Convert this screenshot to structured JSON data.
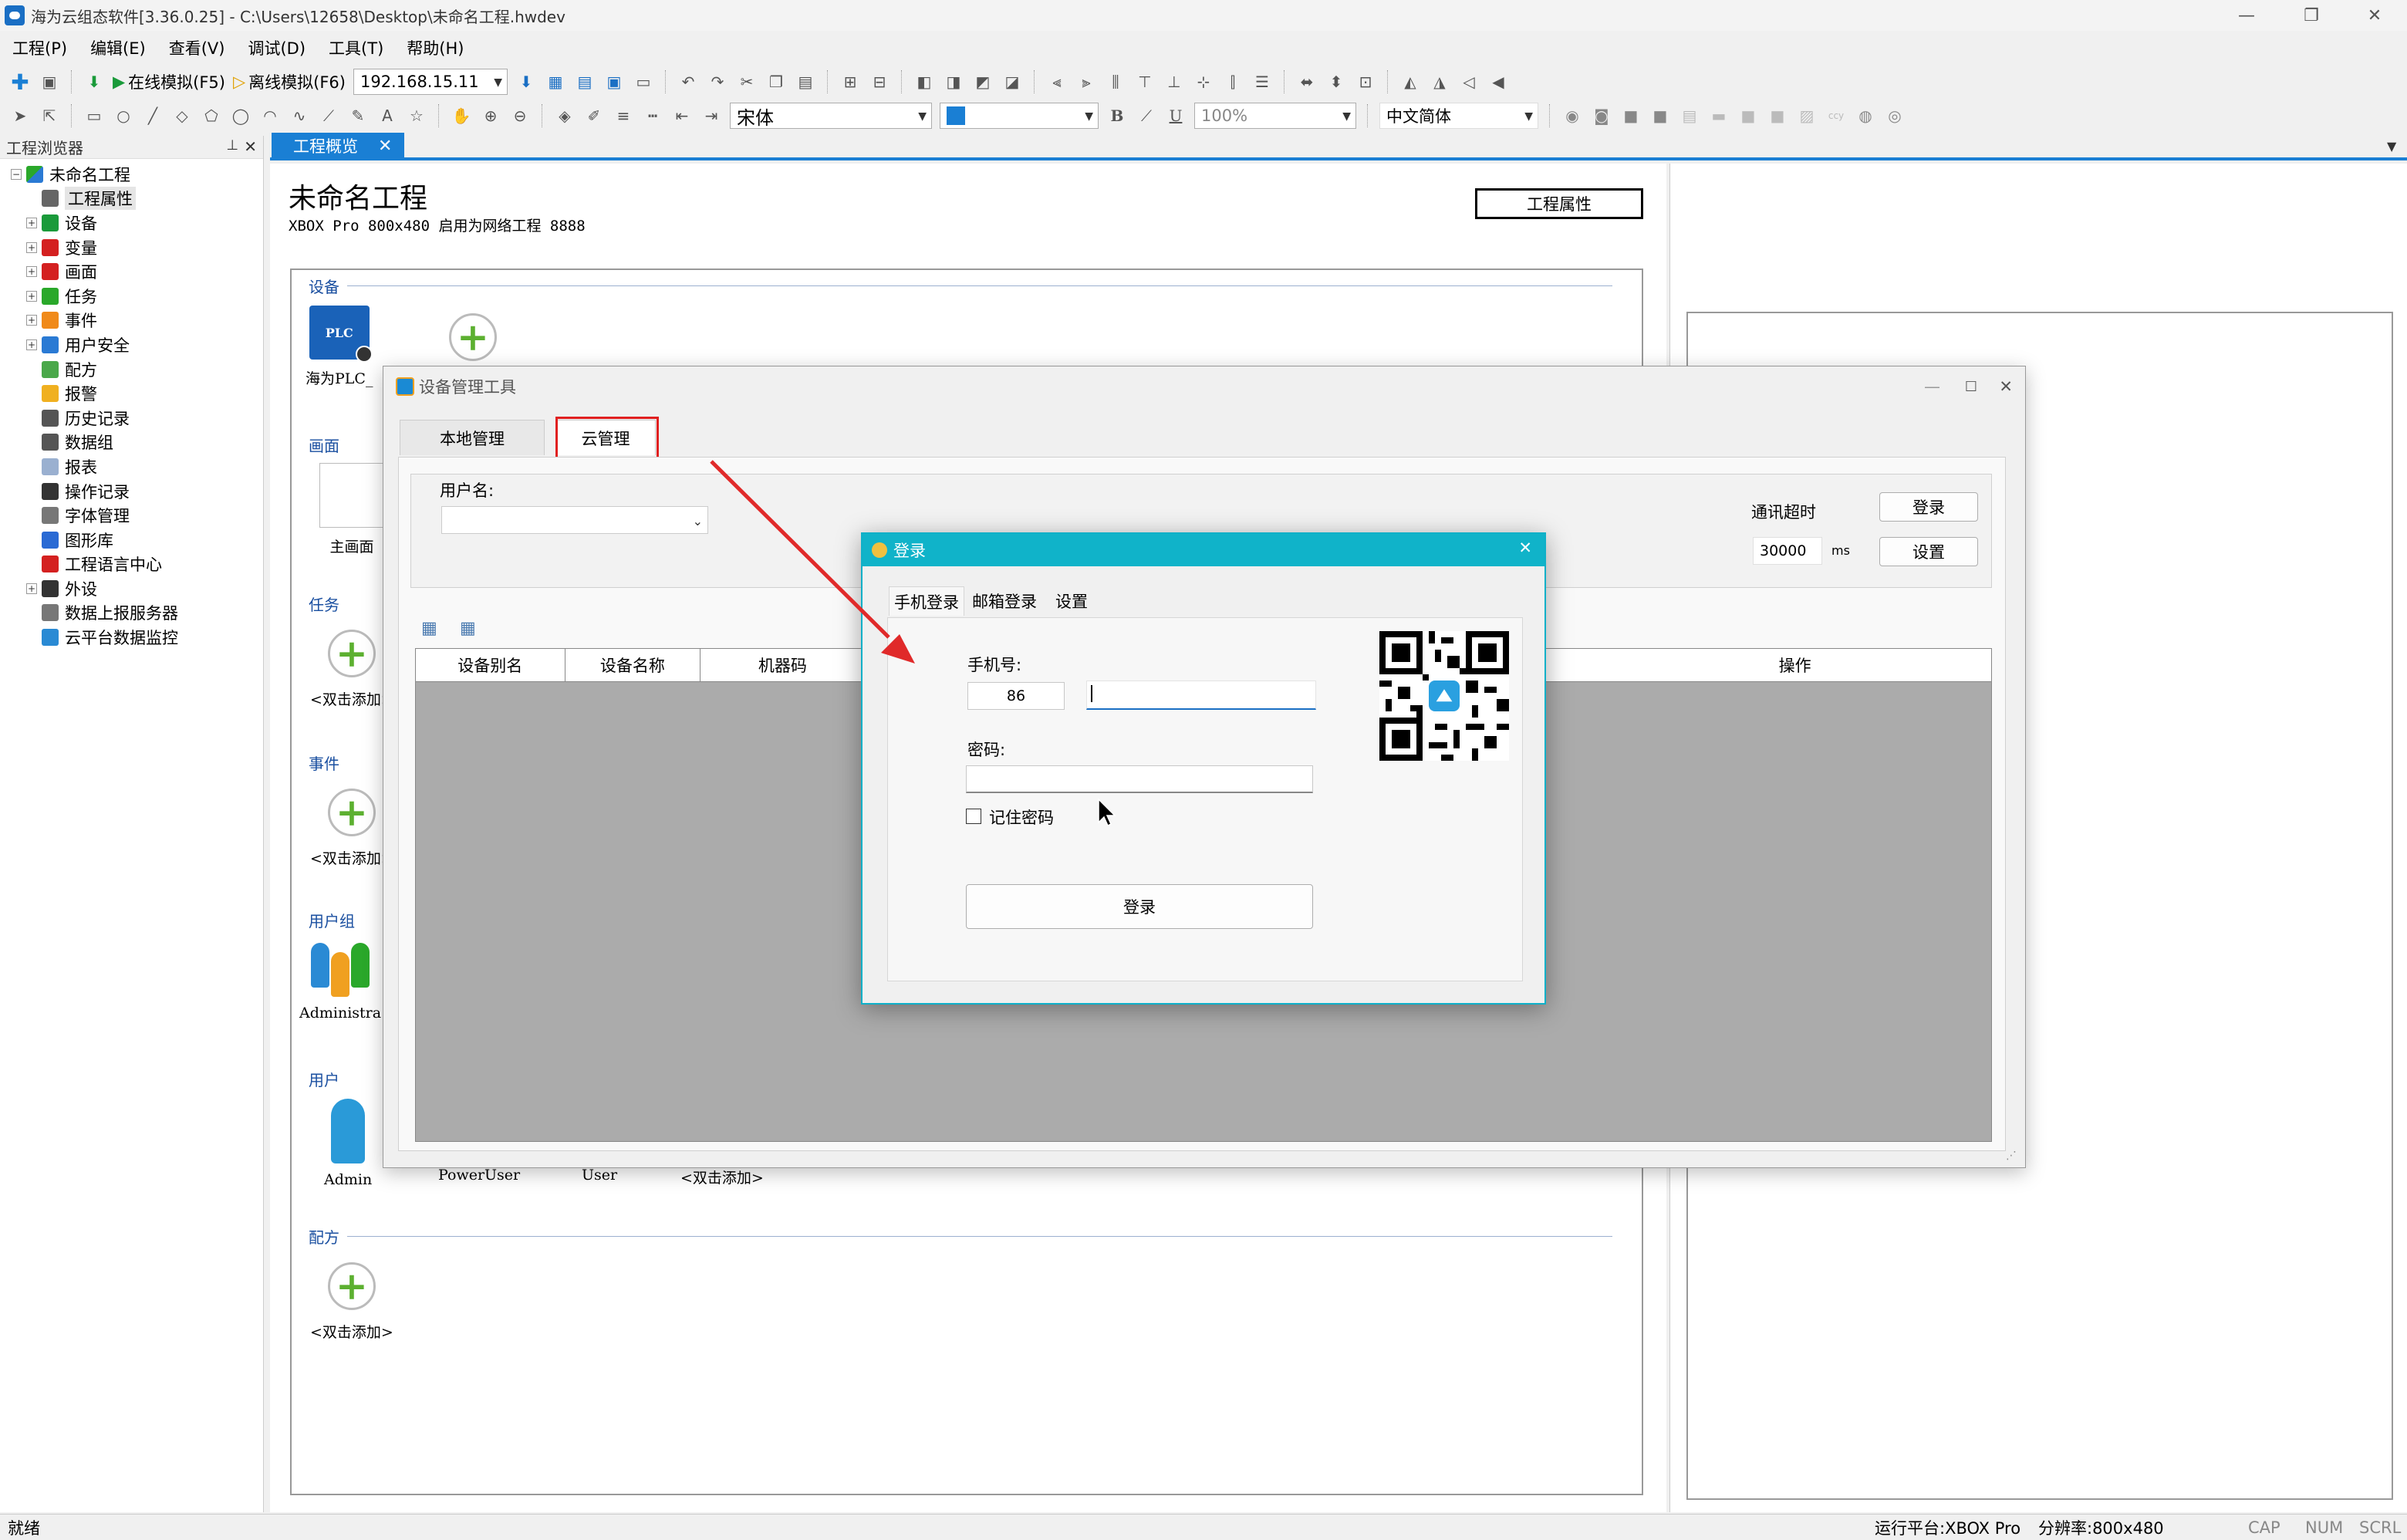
{
  "window": {
    "title": "海为云组态软件[3.36.0.25] - C:\\Users\\12658\\Desktop\\未命名工程.hwdev",
    "min": "—",
    "max": "❐",
    "close": "✕"
  },
  "menu": [
    "工程(P)",
    "编辑(E)",
    "查看(V)",
    "调试(D)",
    "工具(T)",
    "帮助(H)"
  ],
  "toolbar": {
    "online_sim": "在线模拟(F5)",
    "offline_sim": "离线模拟(F6)",
    "ip": "192.168.15.11",
    "font": "宋体",
    "zoom": "100%",
    "lang": "中文简体",
    "bold": "B",
    "italic": "I",
    "underline": "U"
  },
  "explorer": {
    "title": "工程浏览器",
    "pin": "ᵖ",
    "close": "✕",
    "root": "未命名工程",
    "items": [
      {
        "label": "工程属性",
        "exp": false,
        "icon": "properties-icon",
        "color": "#666666"
      },
      {
        "label": "设备",
        "exp": true,
        "icon": "device-icon",
        "color": "#1a9a3a"
      },
      {
        "label": "变量",
        "exp": true,
        "icon": "variable-icon",
        "color": "#d42020"
      },
      {
        "label": "画面",
        "exp": true,
        "icon": "screen-icon",
        "color": "#d42020"
      },
      {
        "label": "任务",
        "exp": true,
        "icon": "task-icon",
        "color": "#2aa82a"
      },
      {
        "label": "事件",
        "exp": true,
        "icon": "event-icon",
        "color": "#f08a1a"
      },
      {
        "label": "用户安全",
        "exp": true,
        "icon": "user-security-icon",
        "color": "#2a7ad4"
      },
      {
        "label": "配方",
        "exp": false,
        "icon": "recipe-icon",
        "color": "#4aa84a"
      },
      {
        "label": "报警",
        "exp": false,
        "icon": "alarm-icon",
        "color": "#f0b020"
      },
      {
        "label": "历史记录",
        "exp": false,
        "icon": "history-icon",
        "color": "#555555"
      },
      {
        "label": "数据组",
        "exp": false,
        "icon": "data-group-icon",
        "color": "#555555"
      },
      {
        "label": "报表",
        "exp": false,
        "icon": "report-icon",
        "color": "#9ab0d0"
      },
      {
        "label": "操作记录",
        "exp": false,
        "icon": "operation-log-icon",
        "color": "#333333"
      },
      {
        "label": "字体管理",
        "exp": false,
        "icon": "font-manager-icon",
        "color": "#777777"
      },
      {
        "label": "图形库",
        "exp": false,
        "icon": "graphics-library-icon",
        "color": "#2a6ad4"
      },
      {
        "label": "工程语言中心",
        "exp": false,
        "icon": "language-center-icon",
        "color": "#d42020"
      },
      {
        "label": "外设",
        "exp": true,
        "icon": "peripheral-icon",
        "color": "#333333"
      },
      {
        "label": "数据上报服务器",
        "exp": false,
        "icon": "report-server-icon",
        "color": "#777777"
      },
      {
        "label": "云平台数据监控",
        "exp": false,
        "icon": "cloud-monitor-icon",
        "color": "#2a8ad4"
      }
    ]
  },
  "doctab": {
    "label": "工程概览",
    "close": "✕"
  },
  "overview": {
    "title": "未命名工程",
    "subtitle": "XBOX Pro  800x480  启用为网络工程 8888",
    "prop_button": "工程属性",
    "sections": {
      "device": "设备",
      "screen": "画面",
      "task": "任务",
      "event": "事件",
      "usergroup": "用户组",
      "user": "用户",
      "recipe": "配方"
    },
    "device_name": "海为PLC_",
    "plc_label": "PLC",
    "screen_name": "主画面",
    "add_label": "<双击添加>",
    "usergroup_name": "Administra",
    "users": [
      "Admin",
      "PowerUser",
      "User"
    ]
  },
  "devmgr": {
    "title": "设备管理工具",
    "tab_local": "本地管理",
    "tab_cloud": "云管理",
    "username_label": "用户名:",
    "timeout_label": "通讯超时",
    "timeout_value": "30000",
    "timeout_unit": "ms",
    "login_btn": "登录",
    "settings_btn": "设置",
    "columns": [
      "设备别名",
      "设备名称",
      "机器码",
      "操作"
    ]
  },
  "login": {
    "title": "登录",
    "tabs": [
      "手机登录",
      "邮箱登录",
      "设置"
    ],
    "phone_label": "手机号:",
    "country_code": "86",
    "phone_value": "",
    "password_label": "密码:",
    "remember": "记住密码",
    "submit": "登录"
  },
  "status": {
    "left": "就绪",
    "platform": "运行平台:XBOX Pro",
    "resolution": "分辨率:800x480",
    "caps": "CAP",
    "num": "NUM",
    "scrl": "SCRL"
  }
}
